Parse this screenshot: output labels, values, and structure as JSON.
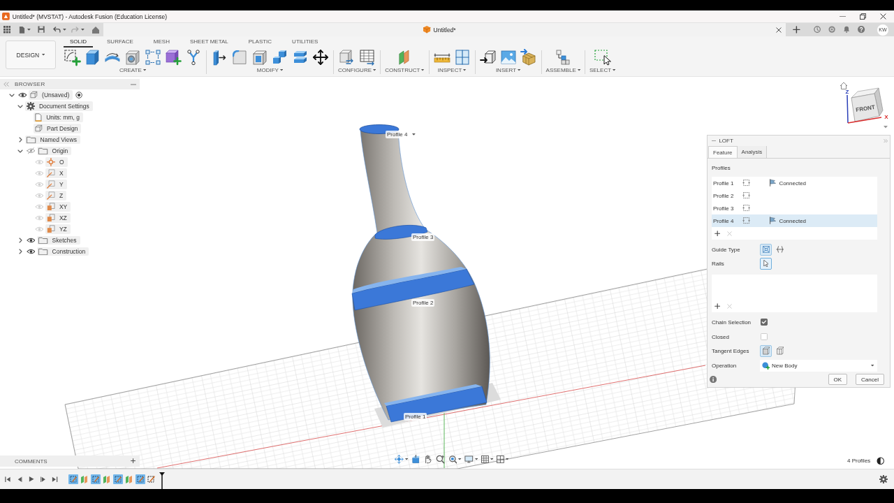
{
  "window": {
    "title": "Untitled* (MVSTAT) - Autodesk Fusion (Education License)"
  },
  "document_tab": {
    "title": "Untitled*"
  },
  "user": {
    "initials": "KW"
  },
  "workspace": {
    "label": "DESIGN"
  },
  "ribbon_tabs": [
    {
      "label": "SOLID",
      "selected": true
    },
    {
      "label": "SURFACE",
      "selected": false
    },
    {
      "label": "MESH",
      "selected": false
    },
    {
      "label": "SHEET METAL",
      "selected": false
    },
    {
      "label": "PLASTIC",
      "selected": false
    },
    {
      "label": "UTILITIES",
      "selected": false
    }
  ],
  "ribbon_groups": [
    {
      "label": "CREATE"
    },
    {
      "label": "MODIFY"
    },
    {
      "label": "CONFIGURE"
    },
    {
      "label": "CONSTRUCT"
    },
    {
      "label": "INSPECT"
    },
    {
      "label": "INSERT"
    },
    {
      "label": "ASSEMBLE"
    },
    {
      "label": "SELECT"
    }
  ],
  "browser": {
    "title": "BROWSER",
    "items": [
      {
        "label": "(Unsaved)",
        "kind": "component",
        "expanded": true,
        "visible": true,
        "active": true,
        "children": [
          {
            "label": "Document Settings",
            "kind": "settings",
            "expanded": true,
            "children": [
              {
                "label": "Units: mm, g",
                "kind": "units"
              },
              {
                "label": "Part Design",
                "kind": "part"
              }
            ]
          },
          {
            "label": "Named Views",
            "kind": "folder",
            "expanded": false
          },
          {
            "label": "Origin",
            "kind": "folder",
            "expanded": true,
            "visible": false,
            "children": [
              {
                "label": "O",
                "kind": "point",
                "visible": false
              },
              {
                "label": "X",
                "kind": "axis",
                "visible": false
              },
              {
                "label": "Y",
                "kind": "axis",
                "visible": false
              },
              {
                "label": "Z",
                "kind": "axis",
                "visible": false
              },
              {
                "label": "XY",
                "kind": "plane",
                "visible": false
              },
              {
                "label": "XZ",
                "kind": "plane",
                "visible": false
              },
              {
                "label": "YZ",
                "kind": "plane",
                "visible": false
              }
            ]
          },
          {
            "label": "Sketches",
            "kind": "folder",
            "expanded": false,
            "visible": true
          },
          {
            "label": "Construction",
            "kind": "folder",
            "expanded": false,
            "visible": true
          }
        ]
      }
    ]
  },
  "viewport": {
    "profile_labels": [
      {
        "label": "Profile 4",
        "menu": true
      },
      {
        "label": "Profile 3",
        "menu": false
      },
      {
        "label": "Profile 2",
        "menu": false
      },
      {
        "label": "Profile 1",
        "menu": false
      }
    ],
    "view_cube": {
      "face": "FRONT",
      "axes": [
        "Z",
        "X"
      ]
    }
  },
  "loft": {
    "title": "LOFT",
    "tabs": [
      {
        "label": "Feature",
        "selected": true
      },
      {
        "label": "Analysis",
        "selected": false
      }
    ],
    "profiles": {
      "label": "Profiles",
      "items": [
        {
          "label": "Profile 1",
          "condition": "Connected",
          "selected": false
        },
        {
          "label": "Profile 2",
          "selected": false
        },
        {
          "label": "Profile 3",
          "selected": false
        },
        {
          "label": "Profile 4",
          "condition": "Connected",
          "selected": true
        }
      ]
    },
    "guide_type": {
      "label": "Guide Type",
      "options": [
        {
          "kind": "rails",
          "selected": true
        },
        {
          "kind": "centerline",
          "selected": false
        }
      ]
    },
    "rails": {
      "label": "Rails"
    },
    "chain_selection": {
      "label": "Chain Selection",
      "checked": true
    },
    "closed": {
      "label": "Closed",
      "checked": false
    },
    "tangent_edges": {
      "label": "Tangent Edges",
      "options": [
        {
          "kind": "merge",
          "selected": true
        },
        {
          "kind": "keep",
          "selected": false
        }
      ]
    },
    "operation": {
      "label": "Operation",
      "value": "New Body"
    },
    "buttons": [
      {
        "label": "OK"
      },
      {
        "label": "Cancel"
      }
    ]
  },
  "comments": {
    "title": "COMMENTS"
  },
  "status": {
    "text": "4 Profiles"
  },
  "timeline": {
    "items": [
      {
        "kind": "sketch",
        "selected": true
      },
      {
        "kind": "plane",
        "selected": false
      },
      {
        "kind": "sketch",
        "selected": true
      },
      {
        "kind": "plane",
        "selected": false
      },
      {
        "kind": "sketch",
        "selected": true
      },
      {
        "kind": "plane",
        "selected": false
      },
      {
        "kind": "sketch",
        "selected": true
      },
      {
        "kind": "sketch",
        "selected": false
      }
    ]
  }
}
